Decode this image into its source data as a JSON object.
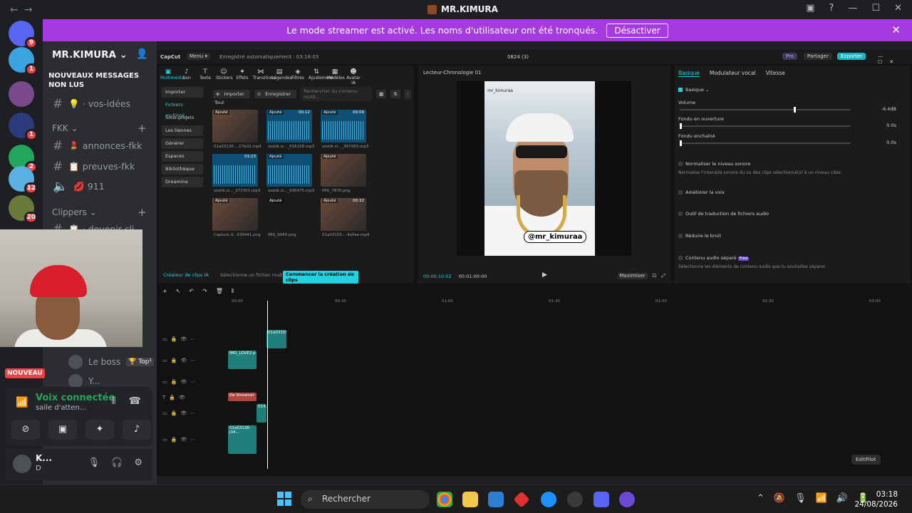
{
  "window": {
    "title": "MR.KIMURA",
    "back": "←",
    "forward": "→"
  },
  "banner": {
    "text": "Le mode streamer est activé. Les noms d'utilisateur ont été tronqués.",
    "button": "Désactiver"
  },
  "servers": [
    {
      "badge": "9",
      "color": "#5865f2"
    },
    {
      "badge": "1",
      "color": "#3ba3e0"
    },
    {
      "badge": "",
      "color": "#7a4a8c"
    },
    {
      "badge": "1",
      "color": "#2b3a7a"
    },
    {
      "badge": "2",
      "color": "#23a55a"
    },
    {
      "badge": "12",
      "color": "#5ab0e0"
    },
    {
      "badge": "20",
      "color": "#6a7a3a"
    }
  ],
  "channels": {
    "server_name": "MR.KIMURA",
    "new_messages": "NOUVEAUX MESSAGES NON LUS",
    "ideas": "💡 · vos-idées",
    "category_fkk": "FKK",
    "annonces": "💄 annonces-fkk",
    "preuves": "📋 preuves-fkk",
    "voice_911": "💋 911",
    "category_clippers": "Clippers",
    "devenir": "📋 · devenir-cli..."
  },
  "members": {
    "boss": "Le boss",
    "boss_tag": "🏆 Top¹",
    "second": "Y..."
  },
  "nouveau": "NOUVEAU",
  "voice": {
    "status": "Voix connectée",
    "channel": "salle d'atten..."
  },
  "user": {
    "name": "K...",
    "status": "D"
  },
  "capcut": {
    "logo": "CapCut",
    "menu": "Menu ▾",
    "autosave": "Enregistré automatiquement : 03:18:03",
    "project": "0824 (3)",
    "pro": "Pro",
    "share": "Partager",
    "export": "Exporter",
    "toolbar": [
      "Multimédia",
      "Son",
      "Texte",
      "Stickers",
      "Effets",
      "Transitions",
      "Légendes",
      "Filtres",
      "Ajustement",
      "Modèles",
      "Avatar IA"
    ],
    "leftnav": [
      "Importer",
      "Fichiers multimé...",
      "Sous-projets",
      "Les tiennes",
      "Générer",
      "Espaces",
      "Bibliothèque",
      "Dreamina"
    ],
    "import_btn": "Importer",
    "record_btn": "Enregistrer",
    "search_placeholder": "Rechercher du contenu multi...",
    "all": "Tout",
    "media": [
      {
        "tag": "Ajouté",
        "dur": "",
        "cap": "01a03136-...17b02.mp4",
        "kind": "img"
      },
      {
        "tag": "Ajouté",
        "dur": "00:12",
        "cap": "sostik.si..._616158.mp3",
        "kind": "audio"
      },
      {
        "tag": "Ajouté",
        "dur": "00:09",
        "cap": "sostik.si..._367955.mp3",
        "kind": "audio"
      },
      {
        "tag": "",
        "dur": "03:23",
        "cap": "sostik.si..._272301.mp3",
        "kind": "audio"
      },
      {
        "tag": "Ajouté",
        "dur": "",
        "cap": "sostik.si..._936475.mp3",
        "kind": "audio"
      },
      {
        "tag": "Ajouté",
        "dur": "",
        "cap": "IMG_7870.png",
        "kind": "img"
      },
      {
        "tag": "Ajouté",
        "dur": "",
        "cap": "Capture d...030441.png",
        "kind": "img"
      },
      {
        "tag": "Ajouté",
        "dur": "",
        "cap": "IMG_6940.png",
        "kind": "img"
      },
      {
        "tag": "Ajouté",
        "dur": "00:32",
        "cap": "01a03155-...4a5ee.mp4",
        "kind": "img"
      }
    ],
    "clip_creator": "Créateur de clips IA",
    "clip_select": "Sélectionne un fichier multi...",
    "clip_start": "Commencer la création de clips",
    "player_title": "Lecteur-Chronologie 01",
    "video_handle": "@mr_kimuraa",
    "video_user": "mr_kimuraa",
    "time_current": "00:00:10:52",
    "time_total": "00:01:00:00",
    "maximize": "Maximiser",
    "tabs": [
      "Basique",
      "Modulateur vocal",
      "Vitesse"
    ],
    "basic": "Basique",
    "volume": "Volume",
    "volume_val": "-6.4dB",
    "fade_in": "Fondu en ouverture",
    "fade_in_val": "0.0s",
    "fade_out": "Fondu enchaîné",
    "fade_out_val": "0.0s",
    "normalize": "Normaliser le niveau sonore",
    "normalize_desc": "Normalise l'intensité sonore du ou des clips sélectionné(s) à un niveau cible.",
    "improve_voice": "Améliorer la voix",
    "translate": "Outil de traduction de fichiers audio",
    "reduce_noise": "Réduire le bruit",
    "separate": "Contenu audio séparé",
    "free": "Free",
    "separate_desc": "Sélectionne les éléments de contenu audio que tu souhaites séparer.",
    "ruler": [
      "00:00",
      "00:30",
      "01:00",
      "01:30",
      "02:00",
      "02:30",
      "03:00"
    ],
    "clips": [
      "01a03155...",
      "IMG_LOVE2.p",
      "De Streamer",
      "014...",
      "01a03136-j34..."
    ],
    "editpilot": "EditPilot"
  },
  "taskbar": {
    "search": "Rechercher",
    "time": "03:18",
    "date": "24/08/2026"
  }
}
